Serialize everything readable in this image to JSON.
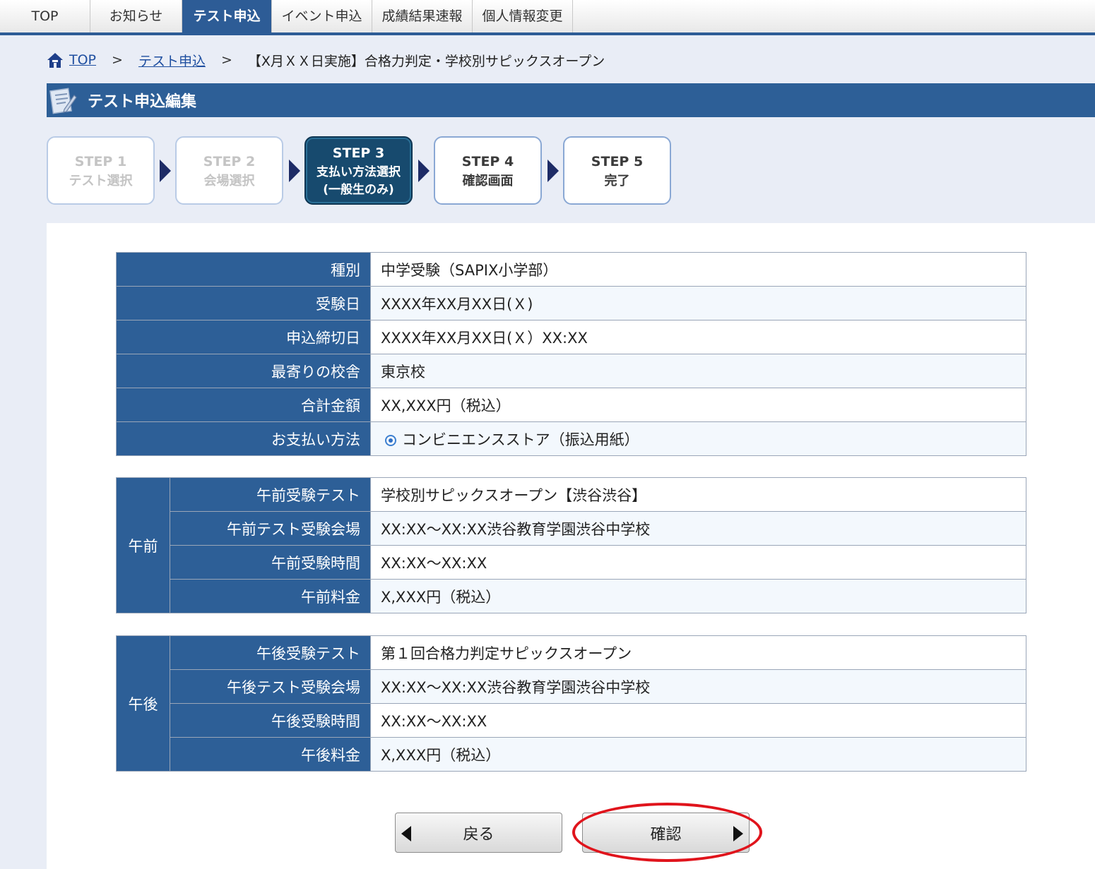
{
  "nav": {
    "tabs": [
      {
        "label": "TOP"
      },
      {
        "label": "お知らせ"
      },
      {
        "label": "テスト申込"
      },
      {
        "label": "イベント申込"
      },
      {
        "label": "成績結果速報"
      },
      {
        "label": "個人情報変更"
      }
    ],
    "active_index": 2
  },
  "breadcrumb": {
    "top": "TOP",
    "sep": ">",
    "apply": "テスト申込",
    "current": "【X月ＸＸ日実施】合格力判定・学校別サピックスオープン"
  },
  "section": {
    "title": "テスト申込編集"
  },
  "steps": [
    {
      "num": "STEP 1",
      "label": "テスト選択",
      "state": "done"
    },
    {
      "num": "STEP 2",
      "label": "会場選択",
      "state": "done"
    },
    {
      "num": "STEP 3",
      "label": "支払い方法選択",
      "label2": "(一般生のみ)",
      "state": "current"
    },
    {
      "num": "STEP 4",
      "label": "確認画面",
      "state": "todo"
    },
    {
      "num": "STEP 5",
      "label": "完了",
      "state": "todo"
    }
  ],
  "summary": {
    "rows": [
      {
        "label": "種別",
        "value": "中学受験（SAPIX小学部）"
      },
      {
        "label": "受験日",
        "value": "XXXX年XX月XX日(Ｘ)"
      },
      {
        "label": "申込締切日",
        "value": "XXXX年XX月XX日(Ｘ）XX:XX"
      },
      {
        "label": "最寄りの校舎",
        "value": "東京校"
      },
      {
        "label": "合計金額",
        "value": "XX,XXX円（税込）"
      },
      {
        "label": "お支払い方法",
        "value": "コンビニエンスストア（振込用紙）"
      }
    ]
  },
  "morning": {
    "group": "午前",
    "rows": [
      {
        "label": "午前受験テスト",
        "value": "学校別サピックスオープン【渋谷渋谷】"
      },
      {
        "label": "午前テスト受験会場",
        "value": "XX:XX～XX:XX渋谷教育学園渋谷中学校"
      },
      {
        "label": "午前受験時間",
        "value": "XX:XX～XX:XX"
      },
      {
        "label": "午前料金",
        "value": "X,XXX円（税込）"
      }
    ]
  },
  "afternoon": {
    "group": "午後",
    "rows": [
      {
        "label": "午後受験テスト",
        "value": "第１回合格力判定サピックスオープン"
      },
      {
        "label": "午後テスト受験会場",
        "value": "XX:XX～XX:XX渋谷教育学園渋谷中学校"
      },
      {
        "label": "午後受験時間",
        "value": "XX:XX～XX:XX"
      },
      {
        "label": "午後料金",
        "value": "X,XXX円（税込）"
      }
    ]
  },
  "buttons": {
    "back": "戻る",
    "confirm": "確認"
  },
  "colors": {
    "primary": "#2d5f97",
    "current_step": "#174a6e",
    "highlight_circle": "#e0141c"
  }
}
